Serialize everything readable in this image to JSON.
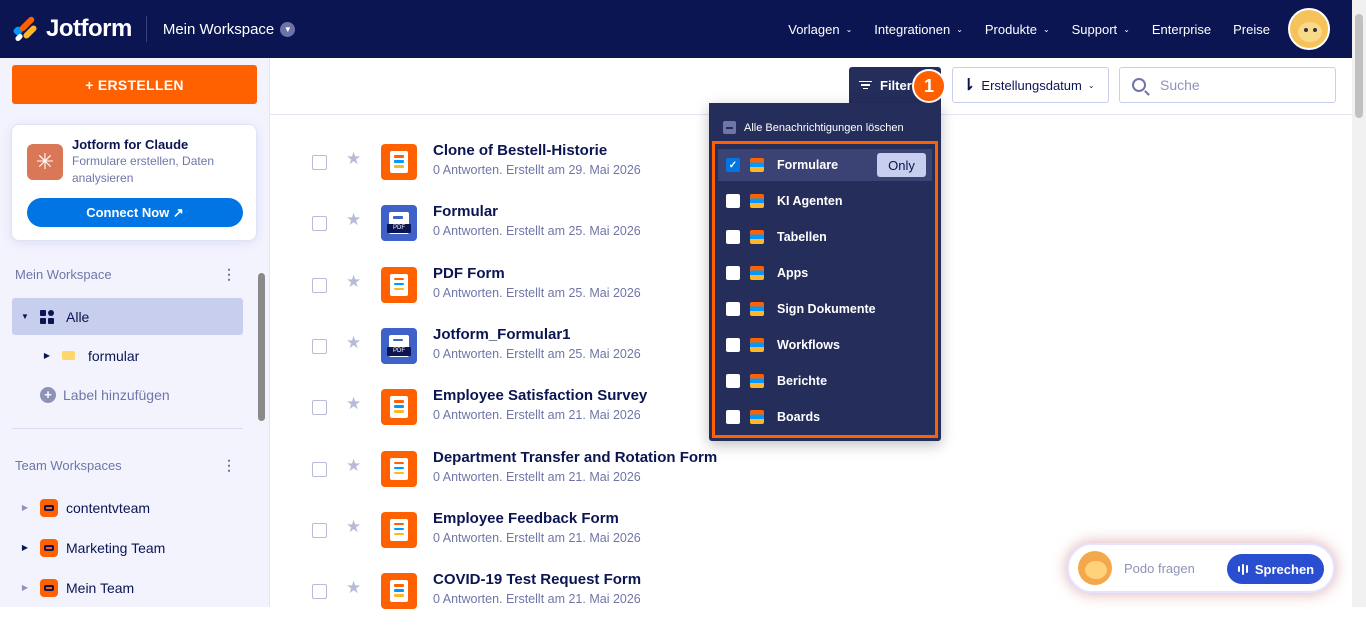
{
  "nav": {
    "brand": "Jotform",
    "workspace": "Mein Workspace",
    "links": [
      "Vorlagen",
      "Integrationen",
      "Produkte",
      "Support",
      "Enterprise",
      "Preise"
    ]
  },
  "sidebar": {
    "create_label": "+ ERSTELLEN",
    "claude": {
      "title": "Jotform for Claude",
      "description": "Formulare erstellen, Daten analysieren",
      "connect_label": "Connect Now ↗"
    },
    "my_workspace_title": "Mein Workspace",
    "all_label": "Alle",
    "folder_label": "formular",
    "add_label": "Label hinzufügen",
    "team_title": "Team Workspaces",
    "teams": [
      "contentvteam",
      "Marketing Team",
      "Mein Team"
    ]
  },
  "toolbar": {
    "filter_label": "Filter",
    "step_number": "1",
    "sort_label": "Erstellungsdatum",
    "search_placeholder": "Suche"
  },
  "dropdown": {
    "clear_label": "Alle Benachrichtigungen löschen",
    "only_label": "Only",
    "options": [
      {
        "label": "Formulare",
        "checked": true
      },
      {
        "label": "KI Agenten",
        "checked": false
      },
      {
        "label": "Tabellen",
        "checked": false
      },
      {
        "label": "Apps",
        "checked": false
      },
      {
        "label": "Sign Dokumente",
        "checked": false
      },
      {
        "label": "Workflows",
        "checked": false
      },
      {
        "label": "Berichte",
        "checked": false
      },
      {
        "label": "Boards",
        "checked": false
      }
    ]
  },
  "forms": [
    {
      "title": "Clone of Bestell-Historie",
      "sub": "0 Antworten. Erstellt am 29. Mai 2026",
      "icon": "form-payment"
    },
    {
      "title": "Formular",
      "sub": "0 Antworten. Erstellt am 25. Mai 2026",
      "icon": "pdf"
    },
    {
      "title": "PDF Form",
      "sub": "0 Antworten. Erstellt am 25. Mai 2026",
      "icon": "form"
    },
    {
      "title": "Jotform_Formular1",
      "sub": "0 Antworten. Erstellt am 25. Mai 2026",
      "icon": "pdf"
    },
    {
      "title": "Employee Satisfaction Survey",
      "sub": "0 Antworten. Erstellt am 21. Mai 2026",
      "icon": "form"
    },
    {
      "title": "Department Transfer and Rotation Form",
      "sub": "0 Antworten. Erstellt am 21. Mai 2026",
      "icon": "form"
    },
    {
      "title": "Employee Feedback Form",
      "sub": "0 Antworten. Erstellt am 21. Mai 2026",
      "icon": "form"
    },
    {
      "title": "COVID-19 Test Request Form",
      "sub": "0 Antworten. Erstellt am 21. Mai 2026",
      "icon": "form"
    }
  ],
  "podo": {
    "placeholder": "Podo fragen",
    "speak_label": "Sprechen"
  },
  "colors": {
    "navy": "#0a1551",
    "orange": "#ff6100",
    "blue": "#0075e3",
    "dropdown_bg": "#252d5b"
  }
}
